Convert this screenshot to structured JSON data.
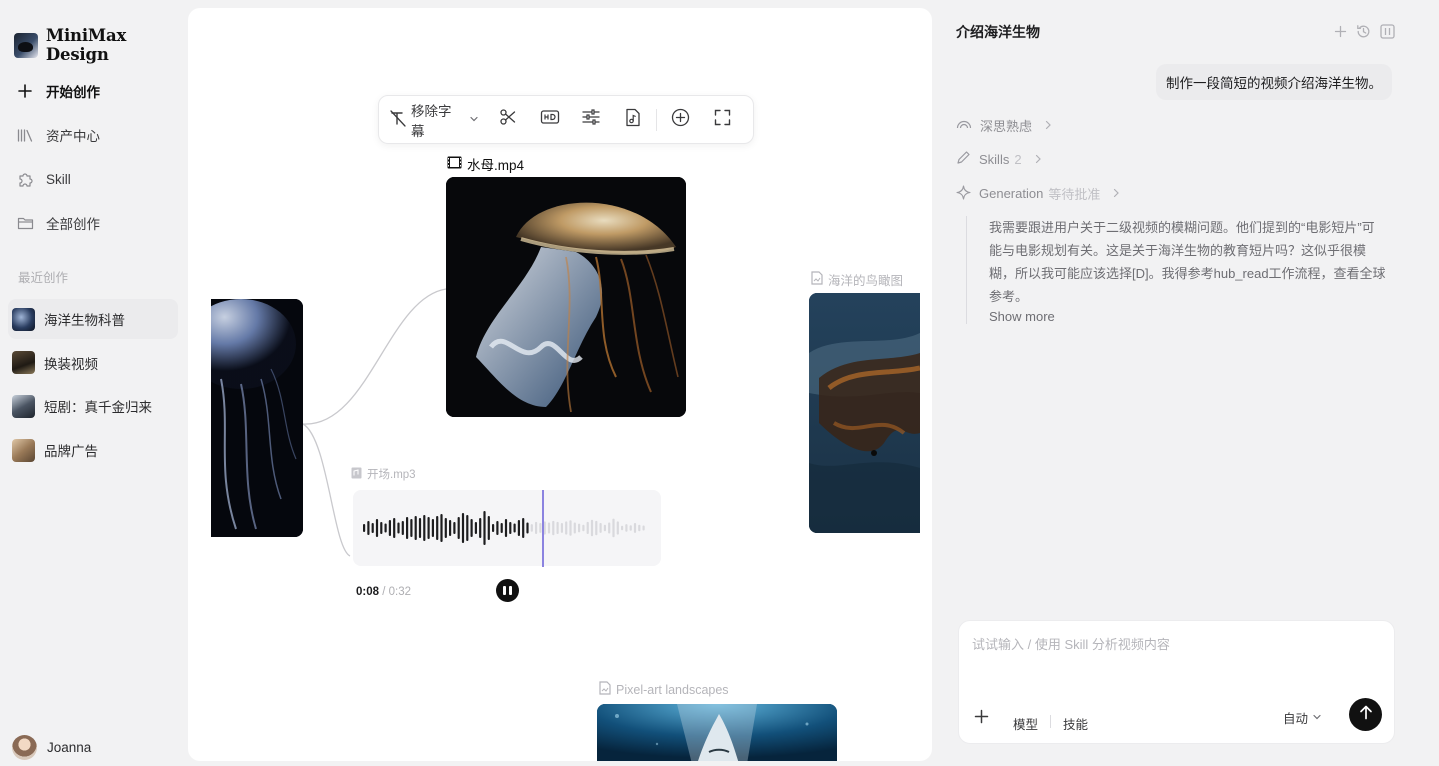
{
  "brand": {
    "name": "MiniMax Design"
  },
  "nav": {
    "new": "开始创作",
    "assets": "资产中心",
    "skill": "Skill",
    "all": "全部创作"
  },
  "recent": {
    "title": "最近创作",
    "items": [
      {
        "label": "海洋生物科普",
        "active": true
      },
      {
        "label": "换装视频",
        "active": false
      },
      {
        "label": "短剧：真千金归来",
        "active": false
      },
      {
        "label": "品牌广告",
        "active": false
      }
    ]
  },
  "user": {
    "name": "Joanna"
  },
  "canvas": {
    "toolbar": {
      "remove_label": "移除字幕"
    },
    "nodes": {
      "main_video": "水母.mp4",
      "right_image": "海洋的鸟瞰图",
      "audio": "开场.mp3",
      "bottom": "Pixel-art landscapes"
    },
    "audio": {
      "current": "0:08",
      "separator": " / ",
      "duration": "0:32",
      "played_fraction": 0.59
    }
  },
  "chat": {
    "title": "介绍海洋生物",
    "user_message": "制作一段简短的视频介绍海洋生物。",
    "steps": {
      "think": "深思熟虑",
      "skills_label": "Skills",
      "skills_count": "2",
      "generation_label": "Generation",
      "generation_status": "等待批准"
    },
    "reasoning": "我需要跟进用户关于二级视频的模糊问题。他们提到的“电影短片”可能与电影规划有关。这是关于海洋生物的教育短片吗？这似乎很模糊，所以我可能应该选择[D]。我得参考hub_read工作流程，查看全球参考。",
    "show_more": "Show more"
  },
  "composer": {
    "placeholder": "试试输入 / 使用 Skill 分析视频内容",
    "model": "模型",
    "skill": "技能",
    "mode": "自动"
  },
  "colors": {
    "accent_playhead": "#8b83e0",
    "primary": "#111111",
    "canvas_bg": "#ffffff",
    "app_bg": "#f2f2f3"
  }
}
